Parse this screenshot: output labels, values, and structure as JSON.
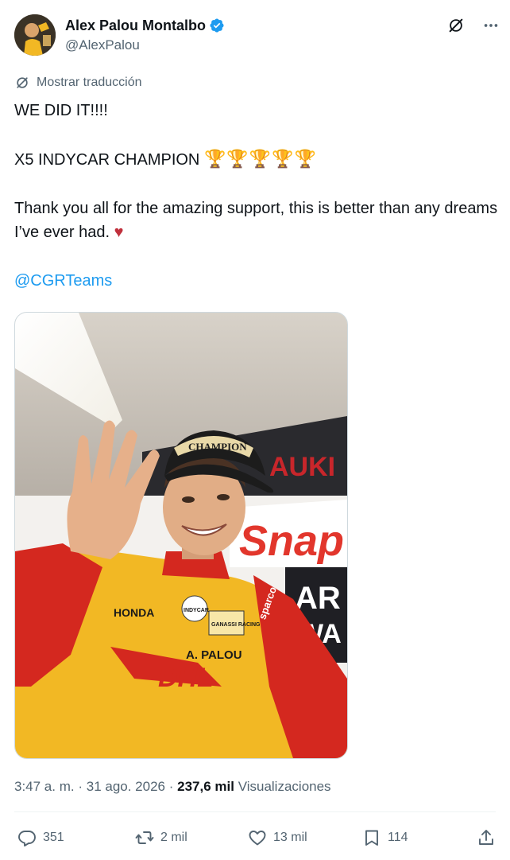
{
  "author": {
    "display_name": "Alex Palou Montalbo",
    "handle": "@AlexPalou",
    "verified": true
  },
  "icons": {
    "verified": "verified-badge-icon",
    "grok": "grok-icon",
    "more": "more-icon",
    "translate": "translate-icon",
    "reply": "reply-icon",
    "repost": "repost-icon",
    "like": "heart-icon",
    "bookmark": "bookmark-icon",
    "share": "share-icon"
  },
  "translate_label": "Mostrar traducción",
  "tweet": {
    "line1": "WE DID IT!!!!",
    "line2": "X5 INDYCAR CHAMPION",
    "line2_emoji": "🏆🏆🏆🏆🏆",
    "line3": "Thank you all for the amazing support, this is better than any dreams I’ve ever had.",
    "line3_emoji": "♥",
    "mention": "@CGRTeams"
  },
  "meta": {
    "time": "3:47 a. m.",
    "date": "31 ago. 2026",
    "views_count": "237,6 mil",
    "views_label": "Visualizaciones"
  },
  "actions": {
    "replies": "351",
    "reposts": "2 mil",
    "likes": "13 mil",
    "bookmarks": "114"
  },
  "media_text": {
    "cap": "CHAMPION",
    "wall1": "AUKI",
    "wall2": "Snap",
    "wall3": "AR",
    "wall4": "WA",
    "suit_honda": "HONDA",
    "suit_name": "A. PALOU",
    "suit_dhl": "DHL",
    "suit_sparco": "sparco",
    "suit_ganassi": "GANASSI RACING",
    "indycar_patch": "INDYCAR"
  },
  "colors": {
    "accent": "#1d9bf0",
    "text": "#0f1419",
    "secondary": "#536471",
    "suit_yellow": "#f2b824",
    "suit_red": "#d4281f"
  }
}
